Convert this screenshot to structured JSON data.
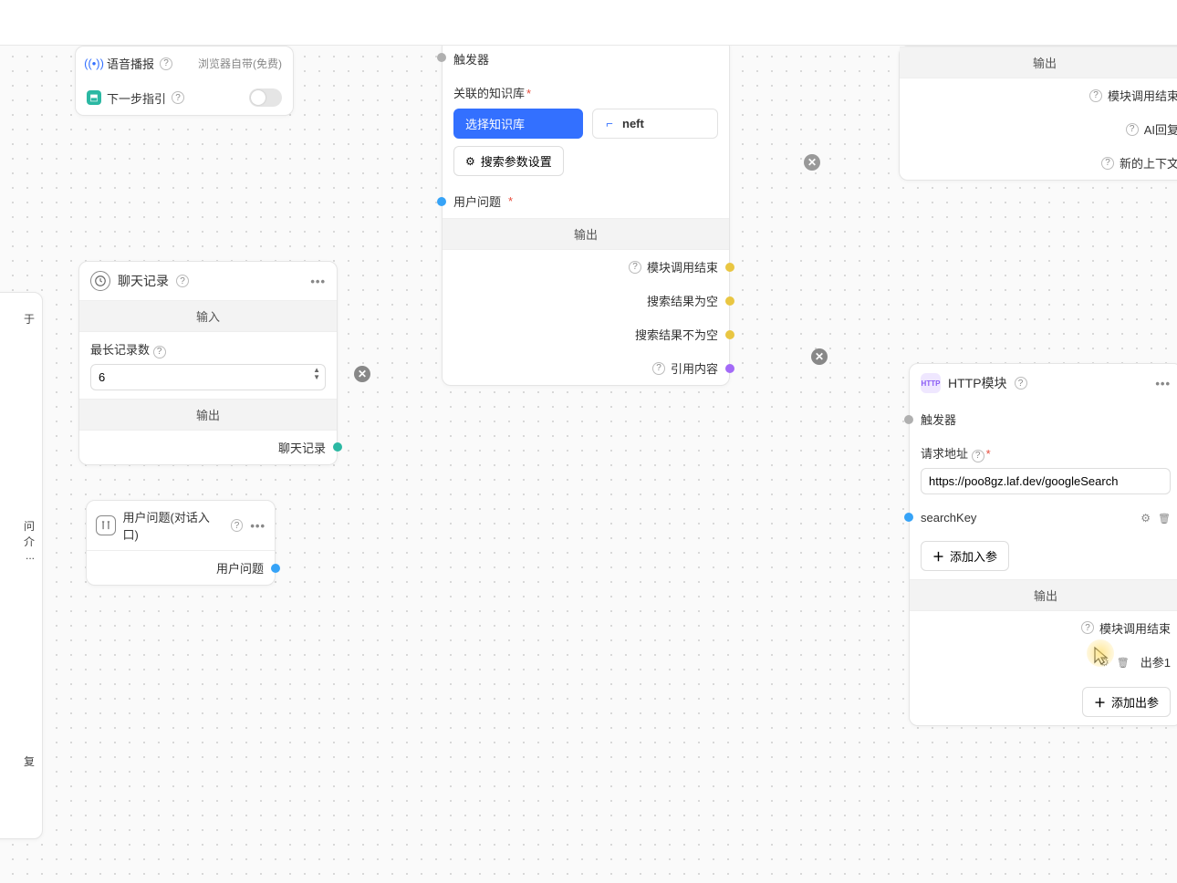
{
  "top_config": {
    "voice_label": "语音播报",
    "voice_value": "浏览器自带(免费)",
    "next_step_label": "下一步指引"
  },
  "kb_node": {
    "trigger": "触发器",
    "linked_kb_label": "关联的知识库",
    "select_kb_btn": "选择知识库",
    "kb_chip": "neft",
    "search_params_btn": "搜索参数设置",
    "user_question_label": "用户问题",
    "output_header": "输出",
    "outputs": {
      "module_done": "模块调用结束",
      "empty": "搜索结果为空",
      "not_empty": "搜索结果不为空",
      "citation": "引用内容"
    }
  },
  "chat_history": {
    "title": "聊天记录",
    "input_header": "输入",
    "max_records_label": "最长记录数",
    "max_records_value": "6",
    "output_header": "输出",
    "output_label": "聊天记录"
  },
  "user_question_node": {
    "title": "用户问题(对话入口)",
    "output_label": "用户问题"
  },
  "output_node": {
    "header": "输出",
    "module_done": "模块调用结束",
    "ai_reply": "AI回复",
    "new_context": "新的上下文"
  },
  "http_node": {
    "title": "HTTP模块",
    "trigger": "触发器",
    "url_label": "请求地址",
    "url_value": "https://poo8gz.laf.dev/googleSearch",
    "param_name": "searchKey",
    "add_input_btn": "添加入参",
    "output_header": "输出",
    "module_done": "模块调用结束",
    "out_param": "出参1",
    "add_output_btn": "添加出参"
  },
  "left_fragment": {
    "line1": "于",
    "line2a": "问",
    "line2b": "介",
    "line2c": "...",
    "line3": "复"
  }
}
